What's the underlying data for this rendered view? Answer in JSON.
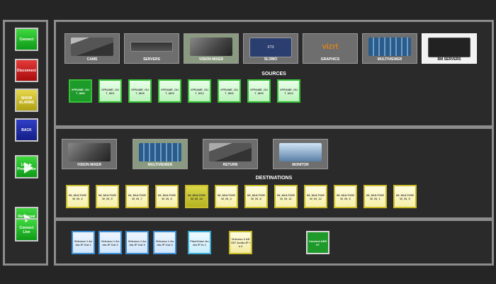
{
  "sidebar": {
    "buttons": [
      {
        "label": "Connect"
      },
      {
        "label": "Disconnect"
      },
      {
        "label": "SHOW ALARMS"
      },
      {
        "label": "BACK"
      },
      {
        "label": "Live ▶ Production"
      },
      {
        "label": "Rehearsal ▶"
      },
      {
        "label": "Connect Live"
      }
    ]
  },
  "sources": {
    "title": "SOURCES",
    "categories": [
      {
        "label": "CAMS"
      },
      {
        "label": "SERVERS"
      },
      {
        "label": "VISION MIXER"
      },
      {
        "label": "SLOMO",
        "art_text": "XT3"
      },
      {
        "label": "GRAPHICS",
        "art_text": "vizrt"
      },
      {
        "label": "MULTIVIEWER"
      },
      {
        "label": "BM SERVERS"
      }
    ],
    "tiles": [
      {
        "label": "XFRAME_OU T_M06"
      },
      {
        "label": "XFRAME_OU T_M01"
      },
      {
        "label": "XFRAME_OU T_M08"
      },
      {
        "label": "XFRAME_OU T_M03"
      },
      {
        "label": "XFRAME_OU T_M12"
      },
      {
        "label": "XFRAME_OU T_M06"
      },
      {
        "label": "XFRAME_OU T_M09"
      },
      {
        "label": "XFRAME_OU T_M10"
      }
    ]
  },
  "destinations": {
    "title": "DESTINATIONS",
    "categories": [
      {
        "label": "VISION MIXER"
      },
      {
        "label": "MULTIVIEWER"
      },
      {
        "label": "RETURN"
      },
      {
        "label": "MONITOR"
      }
    ],
    "tiles": [
      {
        "label": "IM_MULTIVIE W_IN_2"
      },
      {
        "label": "IM_MULTIVIE W_IN_9"
      },
      {
        "label": "IM_MULTIVIE W_IN_7"
      },
      {
        "label": "IM_MULTIVIE W_IN_3"
      },
      {
        "label": "IM_MULTIVIE W_IN_10"
      },
      {
        "label": "IM_MULTIVIE W_IN_4"
      },
      {
        "label": "IM_MULTIVIE W_IN_8"
      },
      {
        "label": "IM_MULTIVIE W_IN_11"
      },
      {
        "label": "IM_MULTIVIE W_IN_12"
      },
      {
        "label": "IM_MULTIVIE W_IN_6"
      },
      {
        "label": "IM_MULTIVIE W_IN_1"
      },
      {
        "label": "IM_MULTIVIE W_IN_5"
      }
    ]
  },
  "bottom": {
    "tiles": [
      {
        "label": "Virtuoso 1 Audio-IP Out 1"
      },
      {
        "label": "Virtuoso 1 Audio-IP Out 2"
      },
      {
        "label": "Virtuoso 1 Audio-IP Out 3"
      },
      {
        "label": "Virtuoso 1 Audio-IP Out 4"
      },
      {
        "label": "FlashCase Audio IP In 1"
      },
      {
        "label": "Virtuoso 2 AES67 Audio-IP In 2"
      },
      {
        "label": "Connect AES67"
      }
    ]
  },
  "colors": {
    "background": "#252525",
    "panel_border": "#8c8c8c",
    "connect_green": "#1e9a2a",
    "disconnect_red": "#c01818",
    "alarm_yellow": "#d4c230",
    "back_blue": "#1e2aa6"
  }
}
